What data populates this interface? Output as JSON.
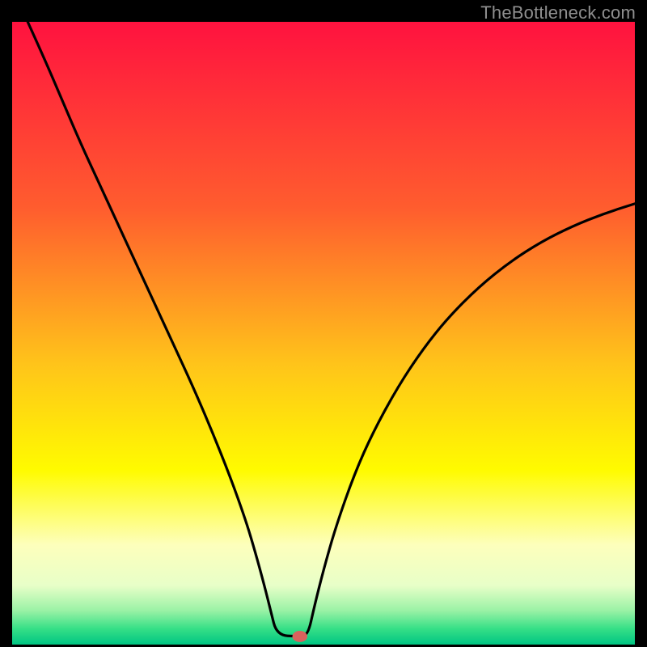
{
  "watermark": "TheBottleneck.com",
  "chart_data": {
    "type": "line",
    "title": "",
    "xlabel": "",
    "ylabel": "",
    "xlim": [
      0,
      100
    ],
    "ylim": [
      0,
      100
    ],
    "grid": false,
    "legend": false,
    "gradient_stops": [
      {
        "offset": 0.0,
        "color": "#ff123f"
      },
      {
        "offset": 0.3,
        "color": "#ff5d2e"
      },
      {
        "offset": 0.55,
        "color": "#ffc41a"
      },
      {
        "offset": 0.72,
        "color": "#fffb00"
      },
      {
        "offset": 0.84,
        "color": "#fdffbc"
      },
      {
        "offset": 0.905,
        "color": "#e8ffc8"
      },
      {
        "offset": 0.945,
        "color": "#9bf2a6"
      },
      {
        "offset": 0.975,
        "color": "#35df86"
      },
      {
        "offset": 1.0,
        "color": "#00c583"
      }
    ],
    "series": [
      {
        "name": "bottleneck-curve",
        "x": [
          2.5,
          5,
          8,
          11,
          14,
          17,
          20,
          23,
          26,
          29,
          32,
          35,
          37.5,
          39,
          40.5,
          41.5,
          42.5,
          46,
          47.5,
          48.5,
          50,
          52,
          55,
          58,
          62,
          66,
          70,
          75,
          80,
          85,
          90,
          95,
          100
        ],
        "y": [
          100,
          94.5,
          87.5,
          80.5,
          74,
          67.5,
          61,
          54.5,
          48,
          41.5,
          34.5,
          27,
          20,
          15,
          9.5,
          5.5,
          1.5,
          1.3,
          1.5,
          6,
          12,
          19,
          27.5,
          34.2,
          41.5,
          47.5,
          52.5,
          57.5,
          61.5,
          64.7,
          67.2,
          69.2,
          70.8
        ]
      }
    ],
    "marker": {
      "x": 46.2,
      "y": 1.3,
      "rx": 1.2,
      "ry": 0.9,
      "color": "#d9625d"
    }
  }
}
